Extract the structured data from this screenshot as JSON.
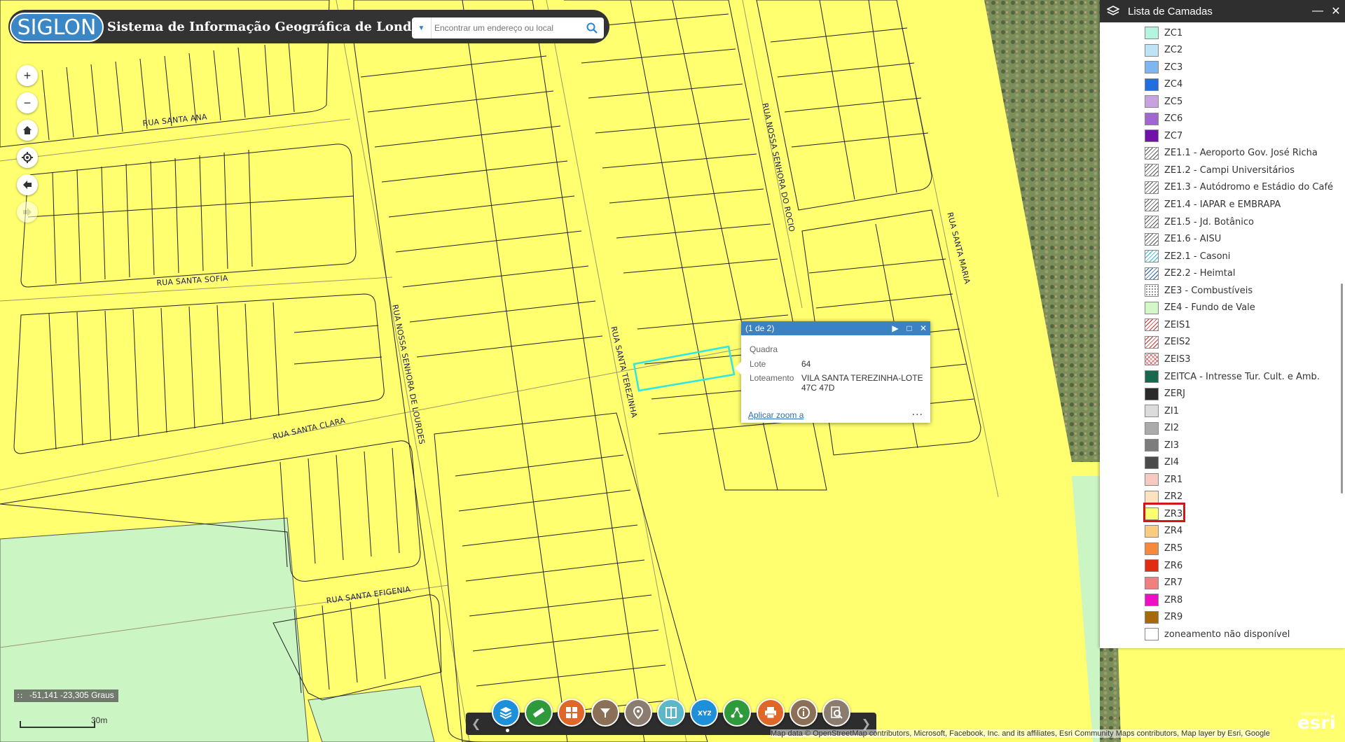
{
  "header": {
    "logo_text": "SIGLON",
    "title": "Sistema de Informação Geográfica de Londrina",
    "search_placeholder": "Encontrar um endereço ou local"
  },
  "streets": [
    "RUA SANTA ANA",
    "RUA SANTA SOFIA",
    "RUA SANTA CLARA",
    "RUA SANTA EFIGENIA",
    "RUA NOSSA SENHORA DE LOURDES",
    "RUA SANTA TEREZINHA",
    "RUA NOSSA SENHORA DO ROCIO",
    "RUA SANTA MARIA"
  ],
  "layer_panel": {
    "title": "Lista de Camadas",
    "highlighted_item": "ZR3",
    "items": [
      {
        "label": "ZC1",
        "color": "#b3f5e1",
        "pattern": "solid"
      },
      {
        "label": "ZC2",
        "color": "#bde3f5",
        "pattern": "solid"
      },
      {
        "label": "ZC3",
        "color": "#7fb5f0",
        "pattern": "solid"
      },
      {
        "label": "ZC4",
        "color": "#1f6fe0",
        "pattern": "solid"
      },
      {
        "label": "ZC5",
        "color": "#c8a2e0",
        "pattern": "solid"
      },
      {
        "label": "ZC6",
        "color": "#a266d3",
        "pattern": "solid"
      },
      {
        "label": "ZC7",
        "color": "#7212a8",
        "pattern": "solid"
      },
      {
        "label": "ZE1.1 - Aeroporto Gov. José Richa",
        "color": "#555555",
        "pattern": "hatch"
      },
      {
        "label": "ZE1.2 - Campi Universitários",
        "color": "#555555",
        "pattern": "hatch"
      },
      {
        "label": "ZE1.3 - Autódromo e Estádio do Café",
        "color": "#555555",
        "pattern": "hatch"
      },
      {
        "label": "ZE1.4 - IAPAR e EMBRAPA",
        "color": "#555555",
        "pattern": "hatch"
      },
      {
        "label": "ZE1.5 - Jd. Botânico",
        "color": "#555555",
        "pattern": "hatch"
      },
      {
        "label": "ZE1.6 - AISU",
        "color": "#555555",
        "pattern": "hatch"
      },
      {
        "label": "ZE2.1 - Casoni",
        "color": "#2bb8d6",
        "pattern": "hatch"
      },
      {
        "label": "ZE2.2 - Heimtal",
        "color": "#1e5aa8",
        "pattern": "hatch"
      },
      {
        "label": "ZE3 - Combustíveis",
        "color": "#888888",
        "pattern": "dots"
      },
      {
        "label": "ZE4 - Fundo de Vale",
        "color": "#d4f7c8",
        "pattern": "solid"
      },
      {
        "label": "ZEIS1",
        "color": "#d42a2a",
        "pattern": "hatch"
      },
      {
        "label": "ZEIS2",
        "color": "#d42a2a",
        "pattern": "hatch"
      },
      {
        "label": "ZEIS3",
        "color": "#e07070",
        "pattern": "cross"
      },
      {
        "label": "ZEITCA - Intresse Tur. Cult. e Amb.",
        "color": "#14694e",
        "pattern": "solid"
      },
      {
        "label": "ZERJ",
        "color": "#2a2a2a",
        "pattern": "solid"
      },
      {
        "label": "ZI1",
        "color": "#dcdcdc",
        "pattern": "solid"
      },
      {
        "label": "ZI2",
        "color": "#ababab",
        "pattern": "solid"
      },
      {
        "label": "ZI3",
        "color": "#7c7c7c",
        "pattern": "solid"
      },
      {
        "label": "ZI4",
        "color": "#4a4a4a",
        "pattern": "solid"
      },
      {
        "label": "ZR1",
        "color": "#f7c9c0",
        "pattern": "solid"
      },
      {
        "label": "ZR2",
        "color": "#fbe3bf",
        "pattern": "solid"
      },
      {
        "label": "ZR3",
        "color": "#ffff70",
        "pattern": "solid"
      },
      {
        "label": "ZR4",
        "color": "#fbcb82",
        "pattern": "solid"
      },
      {
        "label": "ZR5",
        "color": "#f58a3c",
        "pattern": "solid"
      },
      {
        "label": "ZR6",
        "color": "#e22b12",
        "pattern": "solid"
      },
      {
        "label": "ZR7",
        "color": "#f07f7f",
        "pattern": "solid"
      },
      {
        "label": "ZR8",
        "color": "#ee0fc4",
        "pattern": "solid"
      },
      {
        "label": "ZR9",
        "color": "#a8690a",
        "pattern": "solid"
      },
      {
        "label": "zoneamento não disponível",
        "color": "#ffffff",
        "pattern": "solid"
      }
    ]
  },
  "popup": {
    "count": "(1 de 2)",
    "fields": [
      {
        "name": "Quadra",
        "value": ""
      },
      {
        "name": "Lote",
        "value": "64"
      },
      {
        "name": "Loteamento",
        "value": "VILA SANTA TEREZINHA-LOTE 47C 47D"
      }
    ],
    "zoom_link": "Aplicar zoom a",
    "more": "..."
  },
  "status": {
    "coordinates": "-51,141 -23,305 Graus",
    "scale": "30m"
  },
  "toolbar": {
    "tools": [
      {
        "icon": "layers-icon",
        "color": "#1e8fd9"
      },
      {
        "icon": "ruler-icon",
        "color": "#2e9a3c"
      },
      {
        "icon": "basemap-gallery-icon",
        "color": "#e0672a"
      },
      {
        "icon": "filter-icon",
        "color": "#8c6f57"
      },
      {
        "icon": "location-icon",
        "color": "#8b7c70"
      },
      {
        "icon": "swipe-icon",
        "color": "#5ab8c7"
      },
      {
        "icon": "xyz-coordinate-icon",
        "color": "#1e8fd9"
      },
      {
        "icon": "share-icon",
        "color": "#2e9a3c"
      },
      {
        "icon": "print-icon",
        "color": "#e0672a"
      },
      {
        "icon": "info-icon",
        "color": "#8c6f57"
      },
      {
        "icon": "search-map-icon",
        "color": "#8b7c70"
      }
    ]
  },
  "attribution": "Map data © OpenStreetMap contributors, Microsoft, Facebook, Inc. and its affiliates, Esri Community Maps contributors, Map layer by Esri, Google",
  "esri": {
    "powered": "POWERED BY",
    "logo": "esri"
  }
}
